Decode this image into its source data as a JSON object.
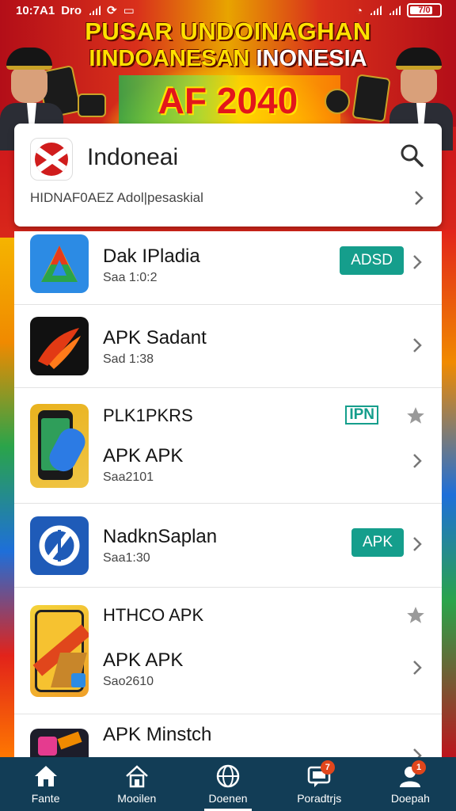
{
  "status_bar": {
    "time": "10:7A1",
    "carrier": "Dro",
    "battery": "7/0"
  },
  "banner": {
    "title": "PUSAR UNDOINAGHAN",
    "subtitle_yellow": "IINDOANESAN ",
    "subtitle_white": "INONESIA",
    "year": "AF 2040"
  },
  "header": {
    "title": "Indoneai",
    "subtitle": "HIDNAF0AEZ Adol|pesaskial",
    "logo_icon": "app-logo-icon",
    "search_icon": "search-icon"
  },
  "apps": [
    {
      "name": "Dak IPladia",
      "meta": "Saa 1:0:2",
      "badge": "ADSD",
      "icon": "triangle-logo-icon"
    },
    {
      "name": "APK Sadant",
      "meta": "Sad 1:38",
      "icon": "swoosh-logo-icon"
    },
    {
      "tag": "PLK1PKRS",
      "tag_badge": "IPN",
      "name": "APK APK",
      "meta": "Saa2101",
      "icon": "phone-app-icon"
    },
    {
      "name": "NadknSaplan",
      "meta": "Saa1:30",
      "badge": "APK",
      "icon": "ap-logo-icon"
    },
    {
      "tag": "HTHCO APK",
      "name": "APK APK",
      "meta": "Sao2610",
      "icon": "phone-banner-icon"
    },
    {
      "name": "APK Minstch",
      "icon": "game-app-icon"
    }
  ],
  "bottom_nav": [
    {
      "label": "Fante",
      "icon": "home-icon"
    },
    {
      "label": "Mooilen",
      "icon": "house-outline-icon"
    },
    {
      "label": "Doenen",
      "icon": "globe-icon"
    },
    {
      "label": "Poradtrjs",
      "icon": "message-icon",
      "badge": "7"
    },
    {
      "label": "Doepah",
      "icon": "profile-icon",
      "badge": "1"
    }
  ],
  "colors": {
    "accent": "#159e8c",
    "nav_bg": "#123d56",
    "banner_red": "#c3141f",
    "banner_yellow": "#ffe100"
  }
}
